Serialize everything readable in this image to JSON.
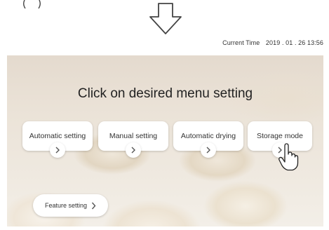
{
  "clock": {
    "label": "Current Time",
    "value": "2019 . 01 . 26  13:56"
  },
  "screen": {
    "heading": "Click on desired menu setting",
    "menu": [
      {
        "label": "Automatic setting"
      },
      {
        "label": "Manual setting"
      },
      {
        "label": "Automatic drying"
      },
      {
        "label": "Storage mode"
      }
    ],
    "feature_button": {
      "label": "Feature setting"
    }
  },
  "icons": {
    "top": "down-arrow-icon",
    "chevrons": "chevron-right-icon",
    "pointer": "hand-pointer-icon"
  },
  "colors": {
    "panel_background": "#ebe3d8",
    "button": "#ffffff",
    "text": "#222222"
  }
}
